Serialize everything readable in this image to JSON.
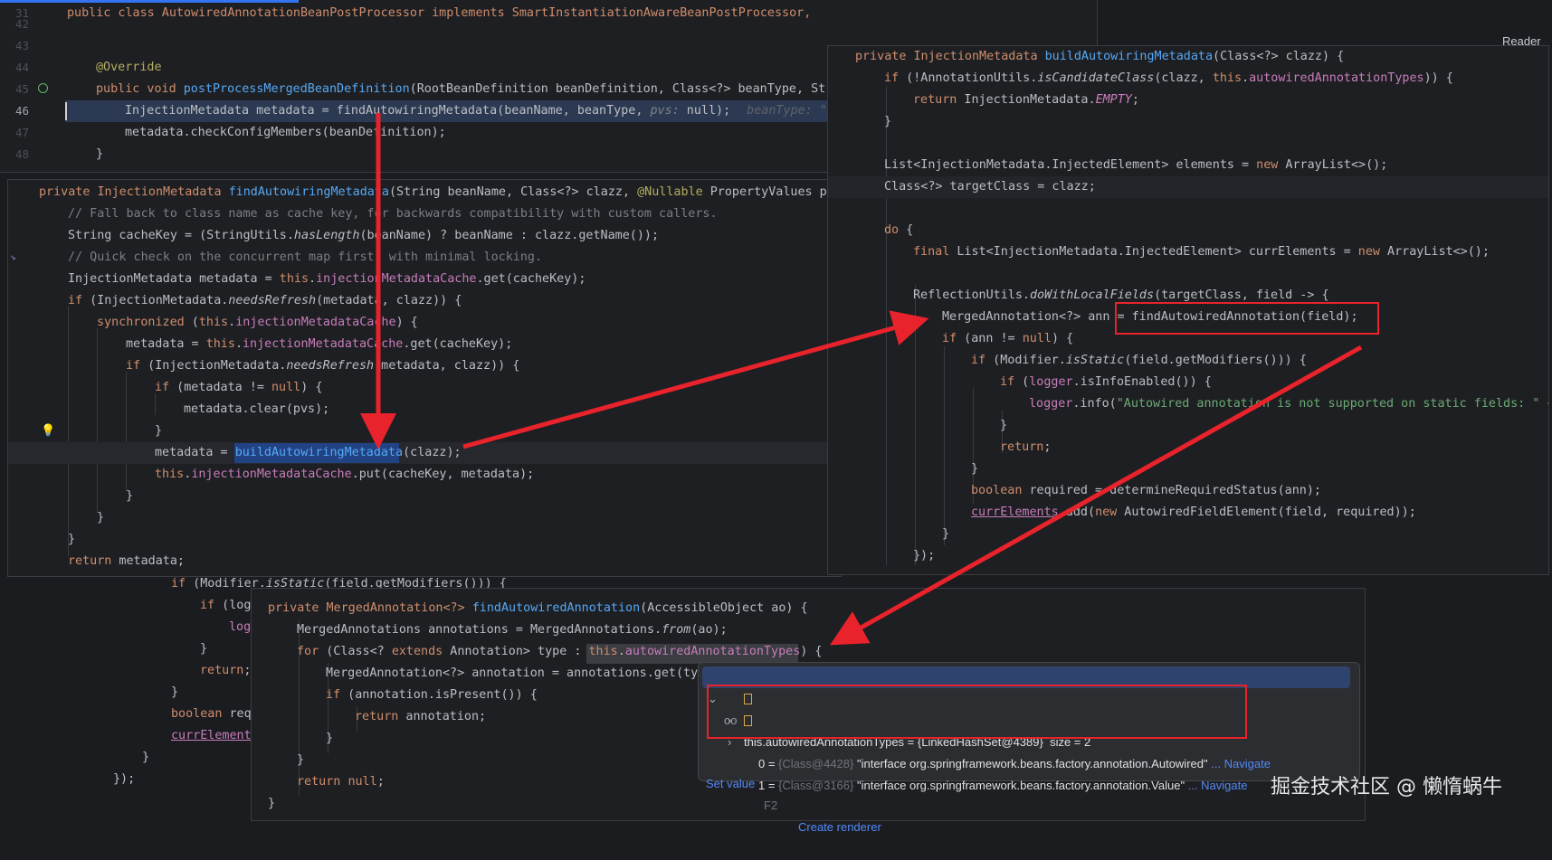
{
  "reader_mode": "Reader M",
  "watermark": "掘金技术社区 @ 懒惰蜗牛",
  "top_panel": {
    "gutter": [
      "31",
      "42",
      "43",
      "44",
      "45",
      "46",
      "47",
      "48"
    ],
    "line_class": [
      "public class AutowiredAnnotationBeanPostProcessor implements SmartInstantiationAwareBeanPostProcessor,"
    ],
    "line_override": "@Override",
    "line_method": [
      "public void ",
      "postProcessMergedBeanDefinition",
      "(RootBeanDefinition beanDefinition, Class<?> beanType, Str"
    ],
    "line_metadata": [
      "InjectionMetadata metadata = findAutowiringMetadata(beanName, beanType, ",
      "pvs:",
      " null);",
      "beanType: \"c"
    ],
    "line_check": "metadata.checkConfigMembers(beanDefinition);",
    "line_close": "}"
  },
  "find_panel": {
    "l1": [
      "private InjectionMetadata ",
      "findAutowiringMetadata",
      "(String beanName, Class<?> clazz, ",
      "@Nullable",
      " PropertyValues pv"
    ],
    "l2": "// Fall back to class name as cache key, for backwards compatibility with custom callers.",
    "l3": [
      "String cacheKey = (StringUtils.",
      "hasLength",
      "(beanName) ? beanName : clazz.getName());"
    ],
    "l4": "// Quick check on the concurrent map first, with minimal locking.",
    "l5": [
      "InjectionMetadata metadata = ",
      "this",
      ".",
      "injectionMetadataCache",
      ".get(cacheKey);"
    ],
    "l6": [
      "if",
      " (InjectionMetadata.",
      "needsRefresh",
      "(metadata, clazz)) {"
    ],
    "l7": [
      "synchronized",
      " (",
      "this",
      ".",
      "injectionMetadataCache",
      ") {"
    ],
    "l8": [
      "metadata = ",
      "this",
      ".",
      "injectionMetadataCache",
      ".get(cacheKey);"
    ],
    "l9": [
      "if",
      " (InjectionMetadata.",
      "needsRefresh",
      "(metadata, clazz)) {"
    ],
    "l10": [
      "if",
      " (metadata != ",
      "null",
      ") {"
    ],
    "l11": "metadata.clear(pvs);",
    "l12": "}",
    "l13": [
      "metadata = ",
      "buildAutowiringMetadata",
      "(clazz);"
    ],
    "l14": [
      "this",
      ".",
      "injectionMetadataCache",
      ".put(cacheKey, metadata);"
    ],
    "l15": "}",
    "l16": "}",
    "l17": "}",
    "l18": [
      "return",
      " metadata;"
    ]
  },
  "build_panel": {
    "l1": [
      "private InjectionMetadata ",
      "buildAutowiringMetadata",
      "(Class<?> clazz) {"
    ],
    "l2": [
      "if",
      " (!AnnotationUtils.",
      "isCandidateClass",
      "(clazz, ",
      "this",
      ".",
      "autowiredAnnotationTypes",
      ")) {"
    ],
    "l3": [
      "return",
      " InjectionMetadata.",
      "EMPTY",
      ";"
    ],
    "l4": "}",
    "l5": [
      "List<InjectionMetadata.InjectedElement> elements = ",
      "new",
      " ArrayList<>();"
    ],
    "l6": "Class<?> targetClass = clazz;",
    "l7": [
      "do",
      " {"
    ],
    "l8": [
      "final",
      " List<InjectionMetadata.InjectedElement> currElements = ",
      "new",
      " ArrayList<>();"
    ],
    "l9": [
      "ReflectionUtils.",
      "doWithLocalFields",
      "(targetClass, field -> {"
    ],
    "l10": "MergedAnnotation<?> ann = findAutowiredAnnotation(field);",
    "l11": [
      "if",
      " (ann != ",
      "null",
      ") {"
    ],
    "l12": [
      "if",
      " (Modifier.",
      "isStatic",
      "(field.getModifiers())) {"
    ],
    "l13": [
      "if",
      " (",
      "logger",
      ".isInfoEnabled()) {"
    ],
    "l14": [
      "logger",
      ".info(",
      "\"Autowired annotation is not supported on static fields: \" +"
    ],
    "l15": "}",
    "l16": [
      "return",
      ";"
    ],
    "l17": "}",
    "l18": [
      "boolean",
      " required = determineRequiredStatus(ann);"
    ],
    "l19": [
      "currElements",
      ".add(",
      "new",
      " AutowiredFieldElement(field, required));"
    ],
    "l20": "}",
    "l21": "});"
  },
  "bg_code": {
    "l1": [
      "if",
      " (Modifier.",
      "isStatic",
      "(field.getModifiers())) {"
    ],
    "l2": [
      "if",
      " (log"
    ],
    "l3": "log",
    "l4": "}",
    "l5": [
      "return",
      ";"
    ],
    "l6": "}",
    "l7": [
      "boolean",
      " req"
    ],
    "l8": "currElement",
    "l9": "}",
    "l10": "});"
  },
  "annot_panel": {
    "l1": [
      "private MergedAnnotation<?> ",
      "findAutowiredAnnotation",
      "(AccessibleObject ao) {"
    ],
    "l2": [
      "MergedAnnotations annotations = MergedAnnotations.",
      "from",
      "(ao);"
    ],
    "l3": [
      "for",
      " (Class<? ",
      "extends",
      " Annotation> type : ",
      "this",
      ".",
      "autowiredAnnotationTypes",
      ") {"
    ],
    "l4": "MergedAnnotation<?> annotation = annotations.get(ty",
    "l5": [
      "if",
      " (annotation.isPresent()) {"
    ],
    "l6": [
      "return",
      " annotation;"
    ],
    "l7": "}",
    "l8": "}",
    "l9": [
      "return",
      " ",
      "null",
      ";"
    ],
    "l10": "}"
  },
  "debug_popup": {
    "header": "this.autowiredAnnotationTypes = {LinkedHashSet@4389}  size = 2",
    "rows": [
      {
        "index": "0 = ",
        "ref": "{Class@4428}",
        "value": " \"interface org.springframework.beans.factory.annotation.Autowired\"",
        "action": " ... Navigate"
      },
      {
        "index": "1 = ",
        "ref": "{Class@3166}",
        "value": " \"interface org.springframework.beans.factory.annotation.Value\"",
        "action": " ... Navigate"
      }
    ],
    "set_value": "Set value",
    "shortcut": "F2",
    "create_renderer": "Create renderer"
  },
  "colors": {
    "red": "#e8232b",
    "keyword": "#cf8e6d",
    "function": "#56a8f5",
    "field": "#c77dbb",
    "comment": "#7a7e85",
    "string": "#6aab73",
    "link": "#548af7"
  }
}
